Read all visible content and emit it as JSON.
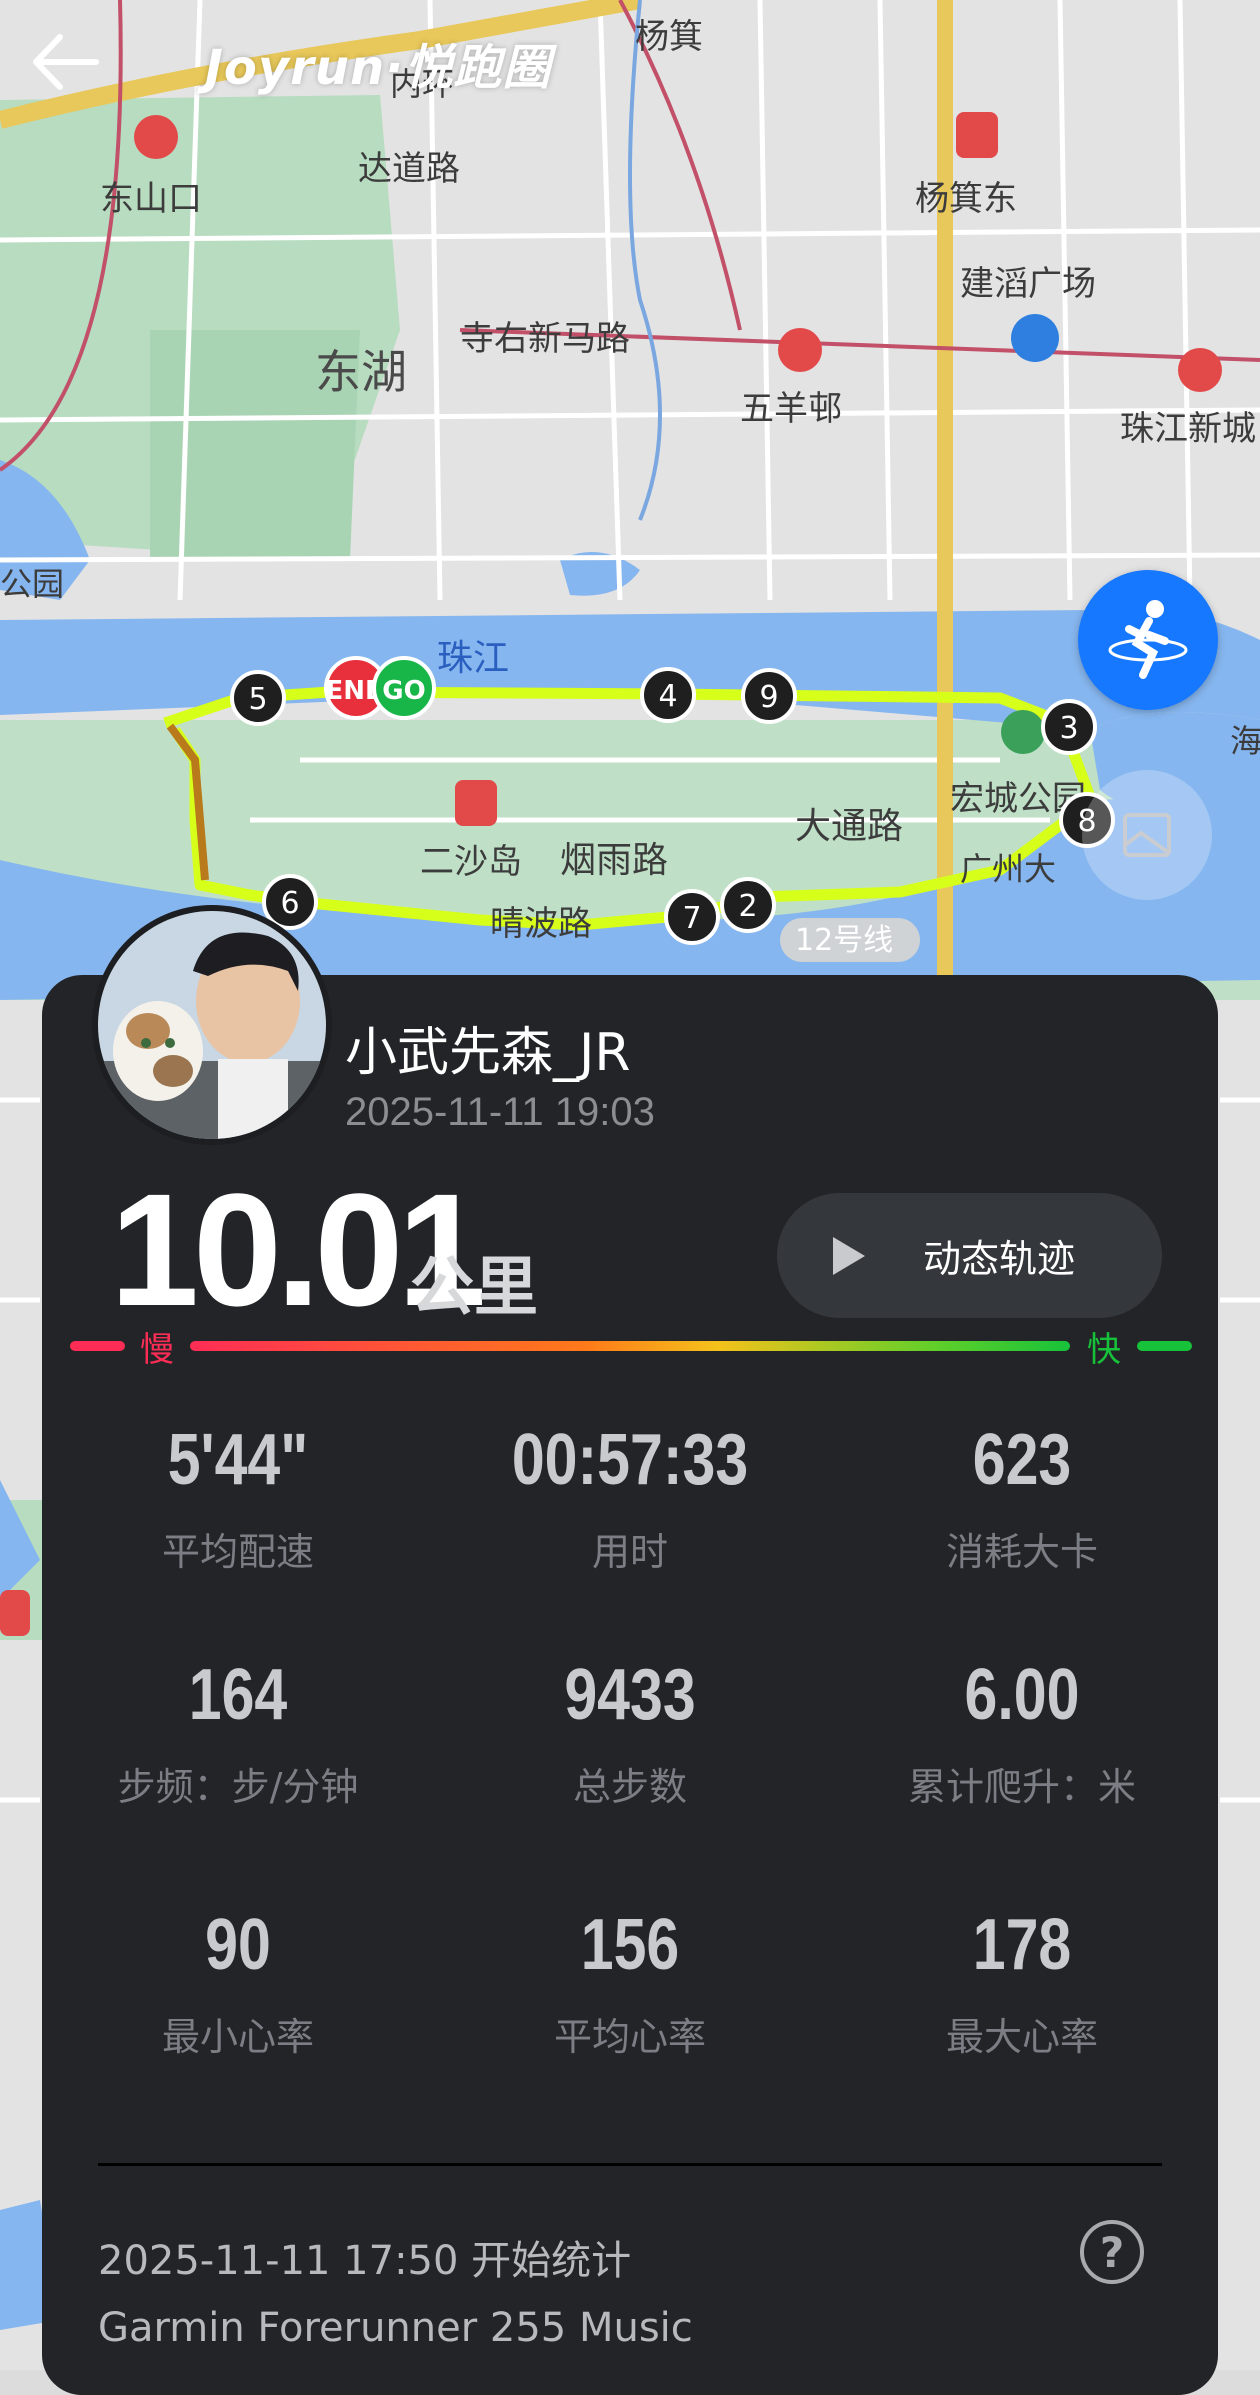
{
  "header": {
    "app_title": "Joyrun·悦跑圈",
    "back_icon": "arrow-left-icon"
  },
  "map": {
    "labels": [
      "杨箕",
      "东山口",
      "达道路",
      "杨箕东",
      "建滔广场",
      "寺右新马路",
      "东湖",
      "五羊邨",
      "珠江新城",
      "公园",
      "珠江",
      "海",
      "宏城公园",
      "大通路",
      "二沙岛",
      "烟雨路",
      "晴波路",
      "12号线",
      "广州大",
      "内环"
    ],
    "markers": {
      "end": "END",
      "go": "GO",
      "kilometers": [
        "2",
        "3",
        "4",
        "5",
        "6",
        "7",
        "8",
        "9"
      ]
    },
    "route_color": "#d6ff1a",
    "run_icon": "runner-icon"
  },
  "profile": {
    "username": "小武先森_JR",
    "run_time": "2025-11-11 19:03"
  },
  "summary": {
    "distance": "10.01",
    "distance_unit": "公里",
    "replay_label": "动态轨迹",
    "slow_label": "慢",
    "fast_label": "快"
  },
  "stats": [
    {
      "value": "5'44\"",
      "label": "平均配速"
    },
    {
      "value": "00:57:33",
      "label": "用时"
    },
    {
      "value": "623",
      "label": "消耗大卡"
    },
    {
      "value": "164",
      "label": "步频：步/分钟"
    },
    {
      "value": "9433",
      "label": "总步数"
    },
    {
      "value": "6.00",
      "label": "累计爬升：米"
    },
    {
      "value": "90",
      "label": "最小心率"
    },
    {
      "value": "156",
      "label": "平均心率"
    },
    {
      "value": "178",
      "label": "最大心率"
    }
  ],
  "footer": {
    "start_stat": "2025-11-11 17:50  开始统计",
    "device": "Garmin Forerunner 255 Music",
    "help_icon": "question-circle-icon"
  },
  "colors": {
    "card_bg": "#222428",
    "accent_blue": "#1677ff",
    "slow": "#ff2d55",
    "fast": "#17c23a"
  }
}
